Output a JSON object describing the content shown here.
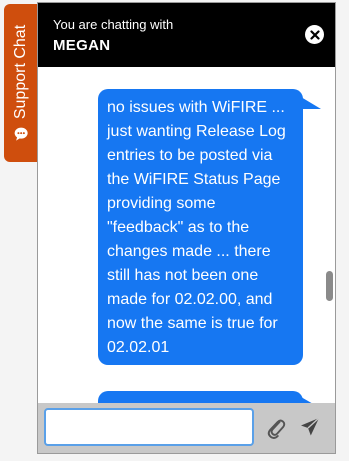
{
  "side_tab": {
    "label": "Support Chat",
    "icon": "chat-bubble-icon",
    "color": "#cf4e0d"
  },
  "header": {
    "subtitle": "You are chatting with",
    "agent_name": "MEGAN",
    "close_icon": "close-icon"
  },
  "messages": [
    {
      "from": "user",
      "text": "no issues with WiFIRE ... just wanting Release Log entries to be posted via the WiFIRE Status Page providing some \"feedback\" as to the changes made ... there still has not been one made for 02.02.00, and now the same is true for 02.02.01"
    },
    {
      "from": "user",
      "text": ""
    }
  ],
  "composer": {
    "value": "",
    "placeholder": "",
    "attach_icon": "paperclip-icon",
    "send_icon": "send-icon"
  },
  "colors": {
    "header": "#000000",
    "bubble": "#1677f2",
    "accent": "#cf4e0d"
  }
}
